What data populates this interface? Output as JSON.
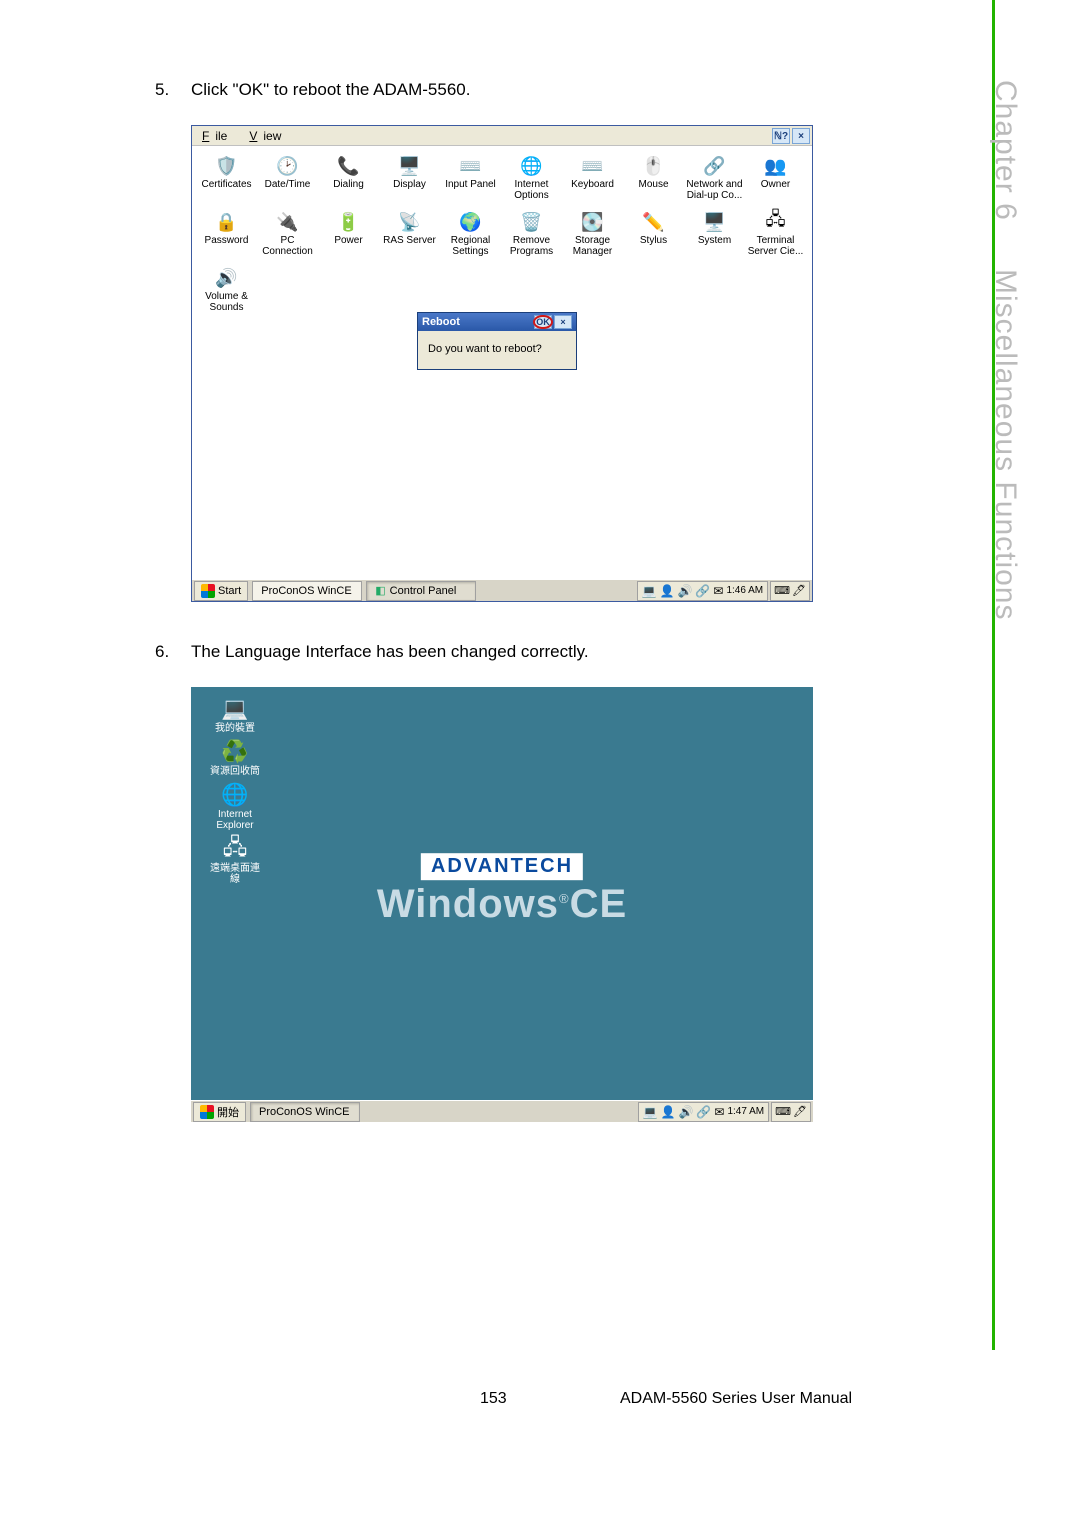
{
  "steps": {
    "s5": {
      "num": "5.",
      "text": "Click \"OK\" to reboot the ADAM-5560."
    },
    "s6": {
      "num": "6.",
      "text": "The Language Interface has been changed correctly."
    }
  },
  "cp": {
    "menu": {
      "file": "File",
      "view": "View"
    },
    "help_btn": "?",
    "close_btn": "×",
    "icons_row1": [
      {
        "label": "Certificates",
        "glyph": "🛡️"
      },
      {
        "label": "Date/Time",
        "glyph": "🕑"
      },
      {
        "label": "Dialing",
        "glyph": "📞"
      },
      {
        "label": "Display",
        "glyph": "🖥️"
      },
      {
        "label": "Input Panel",
        "glyph": "⌨️"
      },
      {
        "label": "Internet\nOptions",
        "glyph": "🌐"
      },
      {
        "label": "Keyboard",
        "glyph": "⌨️"
      },
      {
        "label": "Mouse",
        "glyph": "🖱️"
      },
      {
        "label": "Network and\nDial-up Co...",
        "glyph": "🔗"
      },
      {
        "label": "Owner",
        "glyph": "👥"
      }
    ],
    "icons_row2": [
      {
        "label": "Password",
        "glyph": "🔒"
      },
      {
        "label": "PC\nConnection",
        "glyph": "🔌"
      },
      {
        "label": "Power",
        "glyph": "🔋"
      },
      {
        "label": "RAS Server",
        "glyph": "📡"
      },
      {
        "label": "Regional\nSettings",
        "glyph": "🌍"
      },
      {
        "label": "Remove\nPrograms",
        "glyph": "🗑️"
      },
      {
        "label": "Storage\nManager",
        "glyph": "💽"
      },
      {
        "label": "Stylus",
        "glyph": "✏️"
      },
      {
        "label": "System",
        "glyph": "🖥️"
      },
      {
        "label": "Terminal\nServer Cie...",
        "glyph": "🖧"
      }
    ],
    "icons_row3": [
      {
        "label": "Volume &\nSounds",
        "glyph": "🔊"
      }
    ],
    "reboot": {
      "title": "Reboot",
      "ok": "OK",
      "close": "×",
      "body": "Do you want to reboot?"
    },
    "taskbar": {
      "start": "Start",
      "task1": "ProConOS WinCE",
      "task2": "Control Panel",
      "time": "1:46 AM"
    }
  },
  "desktop": {
    "icons": [
      {
        "label": "我的裝置",
        "glyph": "💻"
      },
      {
        "label": "資源回收筒",
        "glyph": "♻️"
      },
      {
        "label": "Internet\nExplorer",
        "glyph": "🌐"
      },
      {
        "label": "遠端桌面連\n線",
        "glyph": "🖧"
      }
    ],
    "logo_top": "ADVANTECH",
    "logo_main_a": "Windows",
    "logo_main_b": "CE",
    "reg": "®",
    "taskbar": {
      "start": "開始",
      "task1": "ProConOS WinCE",
      "time": "1:47 AM"
    }
  },
  "side": {
    "chapter": "Chapter",
    "num": "6",
    "title": "Miscellaneous Functions"
  },
  "footer": {
    "page": "153",
    "manual": "ADAM-5560 Series User Manual"
  }
}
